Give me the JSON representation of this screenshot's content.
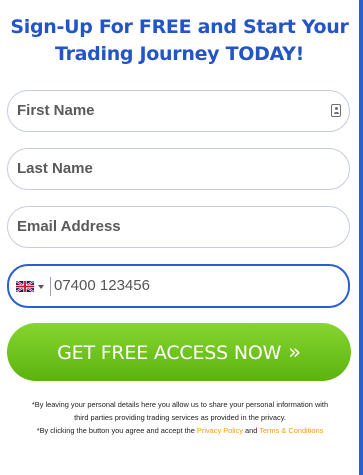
{
  "form": {
    "headline_line1": "Sign-Up For FREE and Start Your",
    "headline_line2": "Trading Journey TODAY!",
    "first_name_placeholder": "First Name",
    "last_name_placeholder": "Last Name",
    "email_placeholder": "Email Address",
    "phone_placeholder": "07400 123456",
    "phone_country": "GB",
    "cta_label": "GET FREE ACCESS NOW",
    "cta_arrow": "»",
    "icons": {
      "autofill": "contact-card-icon",
      "flag": "uk-flag-icon",
      "dropdown": "caret-down-icon"
    }
  },
  "disclaimer": {
    "line1": "*By leaving your personal details here you allow us to share your personal information with third parties providing trading services as provided in the privacy.",
    "line2_prefix": "*By clicking the button you agree and accept the ",
    "privacy_link": "Privacy Policy",
    "and_text": " and ",
    "terms_link": "Terms & Conditions"
  },
  "colors": {
    "headline": "#2355c7",
    "accent_border": "#2a5fd1",
    "cta_green": "#6cc31b",
    "link_orange": "#f39c12"
  }
}
